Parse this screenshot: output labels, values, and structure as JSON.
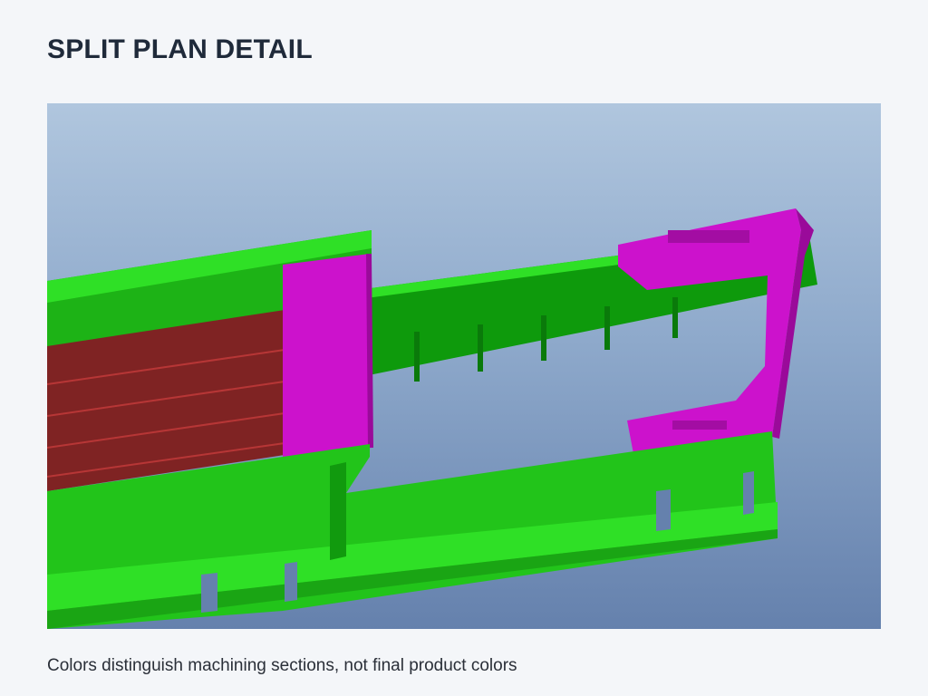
{
  "page": {
    "title": "SPLIT PLAN DETAIL",
    "caption": "Colors distinguish machining sections, not final product colors"
  },
  "model_view": {
    "section_colors": {
      "frame": "#22c41a",
      "frame_dark": "#0e9a0c",
      "frame_light": "#2fe026",
      "section_a": "#cc12cc",
      "section_a_dark": "#9a0a9a",
      "section_b": "#7f2323",
      "section_b_line": "#b73636"
    }
  }
}
